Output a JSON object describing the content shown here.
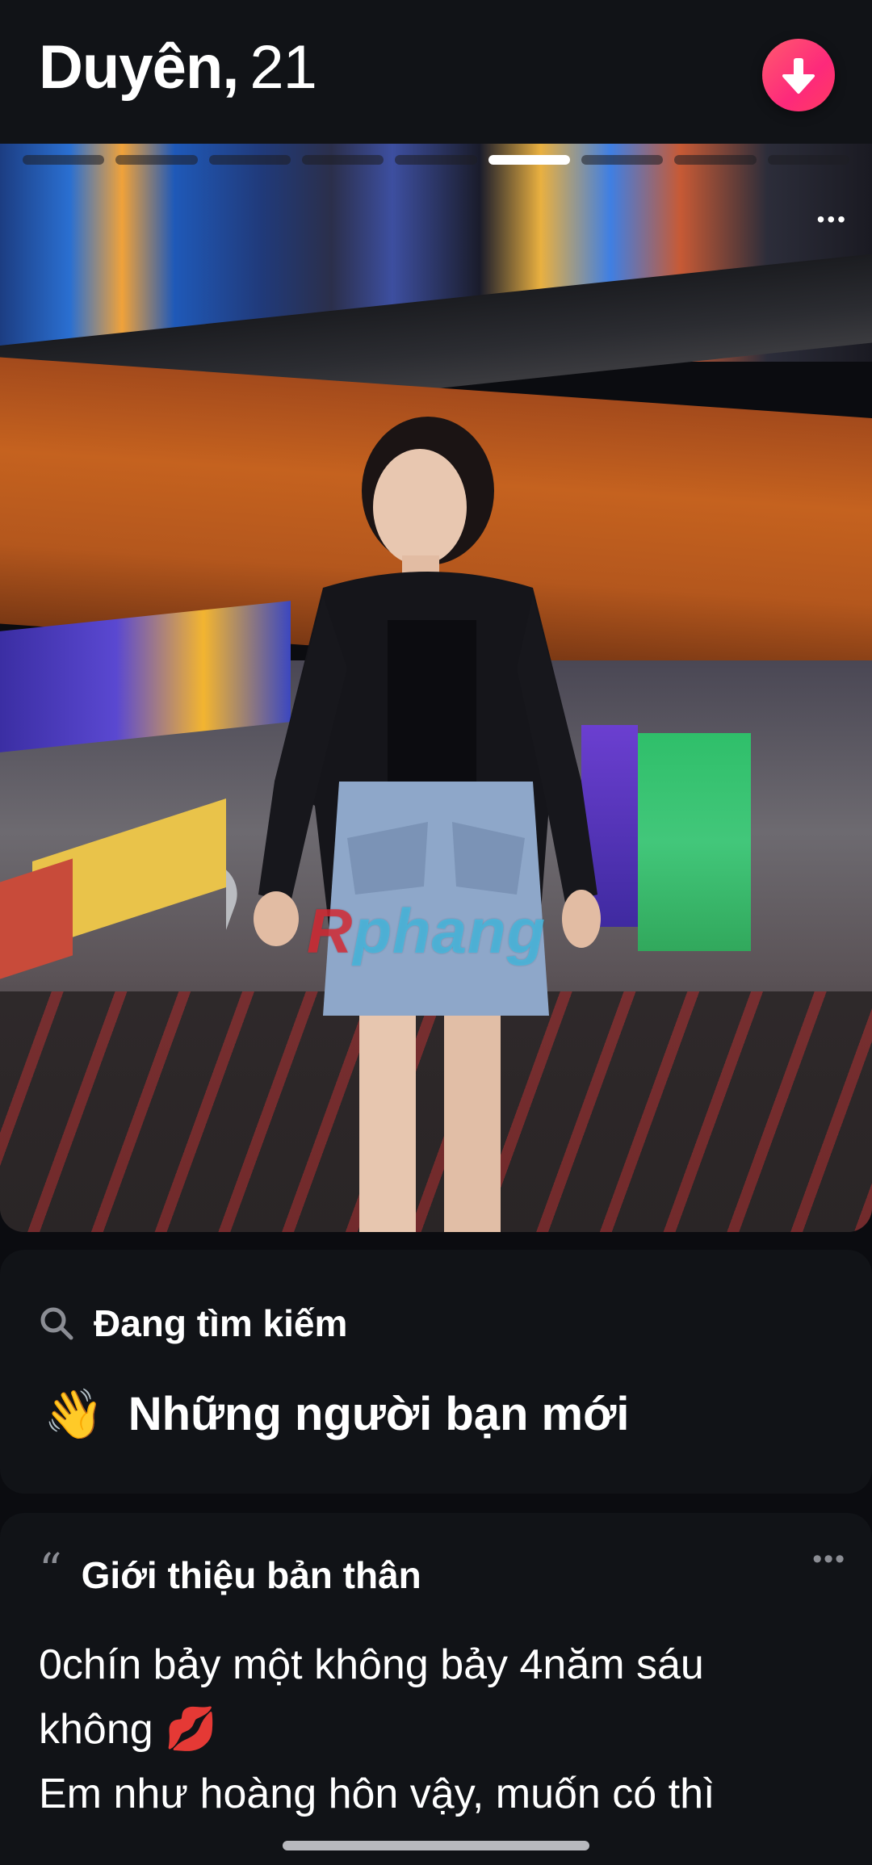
{
  "profile": {
    "name": "Duyên,",
    "age": "21"
  },
  "photo": {
    "total_photos": 9,
    "active_index": 5,
    "watermark_prefix": "R",
    "watermark_rest": "phang"
  },
  "looking_for": {
    "label": "Đang tìm kiếm",
    "emoji": "👋",
    "value": "Những người bạn mới"
  },
  "about": {
    "label": "Giới thiệu bản thân",
    "lines": [
      "0chín bảy một không bảy 4năm sáu",
      "không 💋",
      "Em như hoàng hôn vậy, muốn có thì"
    ]
  },
  "colors": {
    "accent": "#fd297b",
    "background": "#0b0c10",
    "card": "#111317"
  }
}
